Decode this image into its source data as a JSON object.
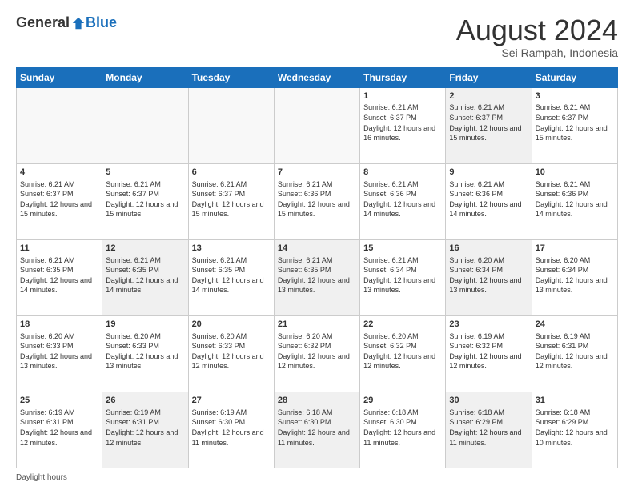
{
  "header": {
    "logo_general": "General",
    "logo_blue": "Blue",
    "main_title": "August 2024",
    "subtitle": "Sei Rampah, Indonesia"
  },
  "footer": {
    "daylight_label": "Daylight hours"
  },
  "days_of_week": [
    "Sunday",
    "Monday",
    "Tuesday",
    "Wednesday",
    "Thursday",
    "Friday",
    "Saturday"
  ],
  "weeks": [
    [
      {
        "day": "",
        "info": "",
        "empty": true
      },
      {
        "day": "",
        "info": "",
        "empty": true
      },
      {
        "day": "",
        "info": "",
        "empty": true
      },
      {
        "day": "",
        "info": "",
        "empty": true
      },
      {
        "day": "1",
        "info": "Sunrise: 6:21 AM\nSunset: 6:37 PM\nDaylight: 12 hours\nand 16 minutes."
      },
      {
        "day": "2",
        "info": "Sunrise: 6:21 AM\nSunset: 6:37 PM\nDaylight: 12 hours\nand 15 minutes."
      },
      {
        "day": "3",
        "info": "Sunrise: 6:21 AM\nSunset: 6:37 PM\nDaylight: 12 hours\nand 15 minutes."
      }
    ],
    [
      {
        "day": "4",
        "info": "Sunrise: 6:21 AM\nSunset: 6:37 PM\nDaylight: 12 hours\nand 15 minutes."
      },
      {
        "day": "5",
        "info": "Sunrise: 6:21 AM\nSunset: 6:37 PM\nDaylight: 12 hours\nand 15 minutes."
      },
      {
        "day": "6",
        "info": "Sunrise: 6:21 AM\nSunset: 6:37 PM\nDaylight: 12 hours\nand 15 minutes."
      },
      {
        "day": "7",
        "info": "Sunrise: 6:21 AM\nSunset: 6:36 PM\nDaylight: 12 hours\nand 15 minutes."
      },
      {
        "day": "8",
        "info": "Sunrise: 6:21 AM\nSunset: 6:36 PM\nDaylight: 12 hours\nand 14 minutes."
      },
      {
        "day": "9",
        "info": "Sunrise: 6:21 AM\nSunset: 6:36 PM\nDaylight: 12 hours\nand 14 minutes."
      },
      {
        "day": "10",
        "info": "Sunrise: 6:21 AM\nSunset: 6:36 PM\nDaylight: 12 hours\nand 14 minutes."
      }
    ],
    [
      {
        "day": "11",
        "info": "Sunrise: 6:21 AM\nSunset: 6:35 PM\nDaylight: 12 hours\nand 14 minutes."
      },
      {
        "day": "12",
        "info": "Sunrise: 6:21 AM\nSunset: 6:35 PM\nDaylight: 12 hours\nand 14 minutes."
      },
      {
        "day": "13",
        "info": "Sunrise: 6:21 AM\nSunset: 6:35 PM\nDaylight: 12 hours\nand 14 minutes."
      },
      {
        "day": "14",
        "info": "Sunrise: 6:21 AM\nSunset: 6:35 PM\nDaylight: 12 hours\nand 13 minutes."
      },
      {
        "day": "15",
        "info": "Sunrise: 6:21 AM\nSunset: 6:34 PM\nDaylight: 12 hours\nand 13 minutes."
      },
      {
        "day": "16",
        "info": "Sunrise: 6:20 AM\nSunset: 6:34 PM\nDaylight: 12 hours\nand 13 minutes."
      },
      {
        "day": "17",
        "info": "Sunrise: 6:20 AM\nSunset: 6:34 PM\nDaylight: 12 hours\nand 13 minutes."
      }
    ],
    [
      {
        "day": "18",
        "info": "Sunrise: 6:20 AM\nSunset: 6:33 PM\nDaylight: 12 hours\nand 13 minutes."
      },
      {
        "day": "19",
        "info": "Sunrise: 6:20 AM\nSunset: 6:33 PM\nDaylight: 12 hours\nand 13 minutes."
      },
      {
        "day": "20",
        "info": "Sunrise: 6:20 AM\nSunset: 6:33 PM\nDaylight: 12 hours\nand 12 minutes."
      },
      {
        "day": "21",
        "info": "Sunrise: 6:20 AM\nSunset: 6:32 PM\nDaylight: 12 hours\nand 12 minutes."
      },
      {
        "day": "22",
        "info": "Sunrise: 6:20 AM\nSunset: 6:32 PM\nDaylight: 12 hours\nand 12 minutes."
      },
      {
        "day": "23",
        "info": "Sunrise: 6:19 AM\nSunset: 6:32 PM\nDaylight: 12 hours\nand 12 minutes."
      },
      {
        "day": "24",
        "info": "Sunrise: 6:19 AM\nSunset: 6:31 PM\nDaylight: 12 hours\nand 12 minutes."
      }
    ],
    [
      {
        "day": "25",
        "info": "Sunrise: 6:19 AM\nSunset: 6:31 PM\nDaylight: 12 hours\nand 12 minutes."
      },
      {
        "day": "26",
        "info": "Sunrise: 6:19 AM\nSunset: 6:31 PM\nDaylight: 12 hours\nand 12 minutes."
      },
      {
        "day": "27",
        "info": "Sunrise: 6:19 AM\nSunset: 6:30 PM\nDaylight: 12 hours\nand 11 minutes."
      },
      {
        "day": "28",
        "info": "Sunrise: 6:18 AM\nSunset: 6:30 PM\nDaylight: 12 hours\nand 11 minutes."
      },
      {
        "day": "29",
        "info": "Sunrise: 6:18 AM\nSunset: 6:30 PM\nDaylight: 12 hours\nand 11 minutes."
      },
      {
        "day": "30",
        "info": "Sunrise: 6:18 AM\nSunset: 6:29 PM\nDaylight: 12 hours\nand 11 minutes."
      },
      {
        "day": "31",
        "info": "Sunrise: 6:18 AM\nSunset: 6:29 PM\nDaylight: 12 hours\nand 10 minutes."
      }
    ]
  ]
}
